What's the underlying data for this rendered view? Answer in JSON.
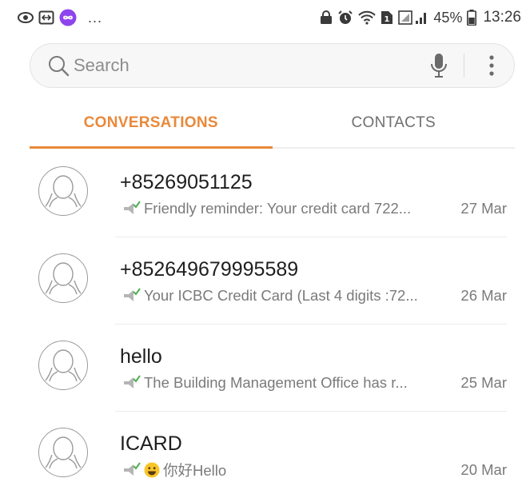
{
  "status_bar": {
    "dots": "...",
    "battery_percent": "45%",
    "time": "13:26",
    "icons": [
      "eye-icon",
      "screen-mirror-icon",
      "infinity-icon",
      "lock-icon",
      "alarm-icon",
      "wifi-icon",
      "sim-icon",
      "signal-icon",
      "battery-icon"
    ]
  },
  "search": {
    "placeholder": "Search",
    "icons": [
      "search-icon",
      "mic-icon",
      "more-vert-icon"
    ]
  },
  "tabs": [
    {
      "label": "CONVERSATIONS",
      "active": true
    },
    {
      "label": "CONTACTS",
      "active": false
    }
  ],
  "accent_color": "#e8893a",
  "conversations": [
    {
      "name": "+85269051125",
      "preview": "Friendly reminder: Your credit card 722...",
      "date": "27 Mar"
    },
    {
      "name": "+852649679995589",
      "preview": "Your ICBC Credit Card (Last 4 digits :72...",
      "date": "26 Mar"
    },
    {
      "name": "hello",
      "preview": "The Building Management Office has r...",
      "date": "25 Mar"
    },
    {
      "name": "ICARD",
      "preview": "你好Hello",
      "date": "20 Mar",
      "emoji": "grinning-face-icon"
    }
  ]
}
